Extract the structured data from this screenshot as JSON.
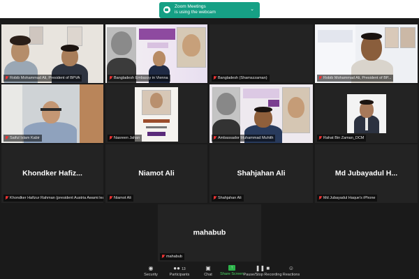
{
  "notification": {
    "line1": "Zoom Meetings",
    "line2": "is using the webcam",
    "icon": "webcam-icon"
  },
  "tiles": [
    {
      "name": "Robib Mohammad Ali, President of BPVA",
      "muted": true,
      "video": true
    },
    {
      "name": "Bangladesh Embassy in Vienna",
      "muted": true,
      "video": true
    },
    {
      "name": "Bangladesh (Shamszzaman)",
      "muted": true,
      "video": false
    },
    {
      "name": "Robib Mohammad Ali, President of BP...",
      "muted": true,
      "video": true
    },
    {
      "name": "Saiful Islam Kabir",
      "muted": true,
      "video": true
    },
    {
      "name": "Nasreen Jahan",
      "muted": true,
      "video": true
    },
    {
      "name": "Ambassador Muhammad Muhith",
      "muted": true,
      "video": true,
      "active": true
    },
    {
      "name": "Rahat Bin Zaman_DCM",
      "muted": true,
      "video": true
    },
    {
      "name": "Khondker Hafizur Rahman (president Austria Awami league)",
      "display": "Khondker Hafiz...",
      "muted": true,
      "video": false
    },
    {
      "name": "Niamot Ali",
      "display": "Niamot Ali",
      "muted": true,
      "video": false
    },
    {
      "name": "Shahjahan Ali",
      "display": "Shahjahan Ali",
      "muted": true,
      "video": false
    },
    {
      "name": "Md Jubayadul Haque's iPhone",
      "display": "Md Jubayadul H...",
      "muted": true,
      "video": false
    },
    {
      "name": "mahabub",
      "display": "mahabub",
      "muted": true,
      "video": false
    }
  ],
  "toolbar": {
    "security": "Security",
    "participants": "Participants",
    "participants_count": "13",
    "chat": "Chat",
    "share_screen": "Share Screen",
    "record": "Pause/Stop Recording",
    "reactions": "Reactions"
  },
  "colors": {
    "background": "#1a1a1a",
    "tile": "#232323",
    "active_border": "#e6d33a",
    "notification": "#16a085",
    "share_green": "#2cb34a",
    "muted_red": "#e33333"
  }
}
